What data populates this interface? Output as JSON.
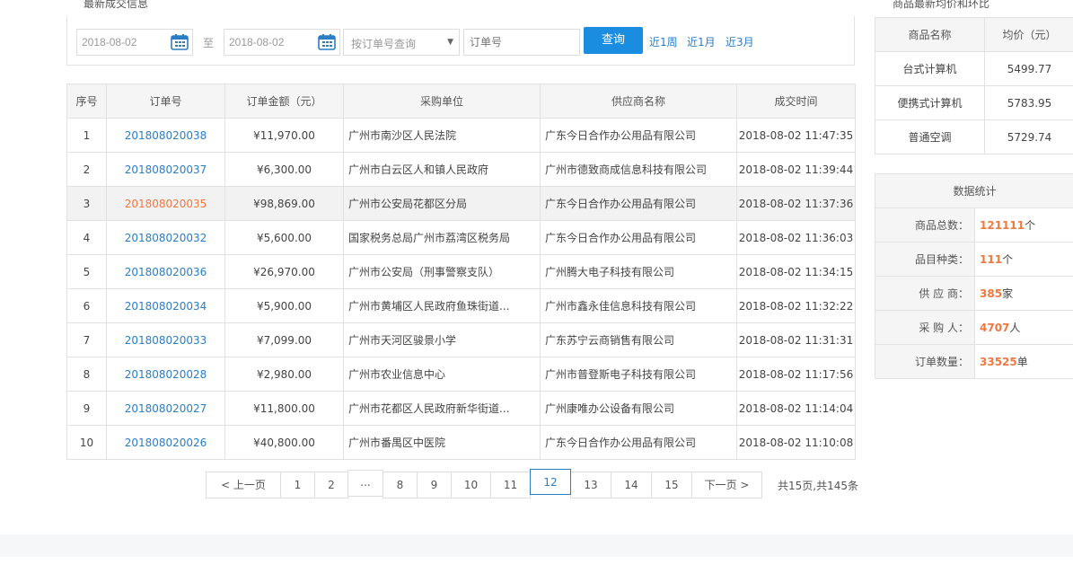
{
  "orders_section": {
    "title": "最新成交信息"
  },
  "price_section": {
    "title": "商品最新均价和环比"
  },
  "search": {
    "start_date": "2018-08-02",
    "to_label": "至",
    "end_date": "2018-08-02",
    "select_value": "按订单号查询",
    "order_placeholder": "订单号",
    "query_button": "查询",
    "quick_links": [
      "近1周",
      "近1月",
      "近3月"
    ]
  },
  "orders_table": {
    "headers": [
      "序号",
      "订单号",
      "订单金额（元）",
      "采购单位",
      "供应商名称",
      "成交时间"
    ],
    "rows": [
      {
        "no": "1",
        "order": "201808020038",
        "amount": "¥11,970.00",
        "buyer": "广州市南沙区人民法院",
        "supplier": "广东今日合作办公用品有限公司",
        "time": "2018-08-02 11:47:35"
      },
      {
        "no": "2",
        "order": "201808020037",
        "amount": "¥6,300.00",
        "buyer": "广州市白云区人和镇人民政府",
        "supplier": "广州市德致商成信息科技有限公司",
        "time": "2018-08-02 11:39:44"
      },
      {
        "no": "3",
        "order": "201808020035",
        "amount": "¥98,869.00",
        "buyer": "广州市公安局花都区分局",
        "supplier": "广东今日合作办公用品有限公司",
        "time": "2018-08-02 11:37:36"
      },
      {
        "no": "4",
        "order": "201808020032",
        "amount": "¥5,600.00",
        "buyer": "国家税务总局广州市荔湾区税务局",
        "supplier": "广东今日合作办公用品有限公司",
        "time": "2018-08-02 11:36:03"
      },
      {
        "no": "5",
        "order": "201808020036",
        "amount": "¥26,970.00",
        "buyer": "广州市公安局（刑事警察支队）",
        "supplier": "广州腾大电子科技有限公司",
        "time": "2018-08-02 11:34:15"
      },
      {
        "no": "6",
        "order": "201808020034",
        "amount": "¥5,900.00",
        "buyer": "广州市黄埔区人民政府鱼珠街道...",
        "supplier": "广州市鑫永佳信息科技有限公司",
        "time": "2018-08-02 11:32:22"
      },
      {
        "no": "7",
        "order": "201808020033",
        "amount": "¥7,099.00",
        "buyer": "广州市天河区骏景小学",
        "supplier": "广东苏宁云商销售有限公司",
        "time": "2018-08-02 11:31:31"
      },
      {
        "no": "8",
        "order": "201808020028",
        "amount": "¥2,980.00",
        "buyer": "广州市农业信息中心",
        "supplier": "广州市普登斯电子科技有限公司",
        "time": "2018-08-02 11:17:56"
      },
      {
        "no": "9",
        "order": "201808020027",
        "amount": "¥11,800.00",
        "buyer": "广州市花都区人民政府新华街道...",
        "supplier": "广州康唯办公设备有限公司",
        "time": "2018-08-02 11:14:04"
      },
      {
        "no": "10",
        "order": "201808020026",
        "amount": "¥40,800.00",
        "buyer": "广州市番禺区中医院",
        "supplier": "广东今日合作办公用品有限公司",
        "time": "2018-08-02 11:10:08"
      }
    ]
  },
  "pagination": {
    "prev": "< 上一页",
    "pages": [
      "1",
      "2",
      "...",
      "8",
      "9",
      "10",
      "11",
      "12",
      "13",
      "14",
      "15"
    ],
    "current": "12",
    "next": "下一页 >",
    "total": "共15页,共145条"
  },
  "price_table": {
    "headers": [
      "商品名称",
      "均价（元）"
    ],
    "rows": [
      {
        "name": "台式计算机",
        "price": "5499.77"
      },
      {
        "name": "便携式计算机",
        "price": "5783.95"
      },
      {
        "name": "普通空调",
        "price": "5729.74"
      }
    ]
  },
  "stats": {
    "title": "数据统计",
    "rows": [
      {
        "label": "商品总数：",
        "value": "121111",
        "unit": "个"
      },
      {
        "label": "品目种类：",
        "value": "111",
        "unit": "个"
      },
      {
        "label": "供 应 商：",
        "value": "385",
        "unit": "家"
      },
      {
        "label": "采 购 人：",
        "value": "4707",
        "unit": "人"
      },
      {
        "label": "订单数量：",
        "value": "33525",
        "unit": "单"
      }
    ]
  },
  "colors": {
    "accent": "#1a8de1",
    "link": "#2b7ec4",
    "highlight": "#f07840"
  }
}
